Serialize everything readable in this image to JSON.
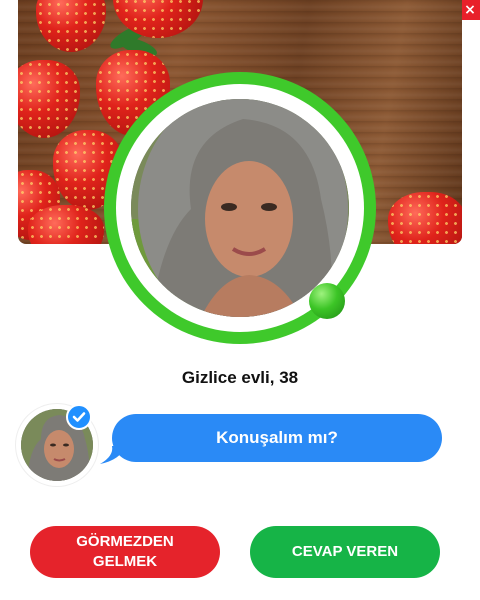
{
  "close": {
    "label": "×",
    "color": "#e8202a"
  },
  "profile": {
    "name_age": "Gizlice evli, 38",
    "online": true
  },
  "message": {
    "text": "Konuşalım mı?",
    "verified": true
  },
  "buttons": {
    "ignore_line1": "GÖRMEZDEN",
    "ignore_line2": "GELMEK",
    "reply": "CEVAP VEREN"
  },
  "colors": {
    "ring": "#3fc92b",
    "bubble": "#2a8af6",
    "ignore": "#e5232b",
    "reply": "#16b447"
  }
}
